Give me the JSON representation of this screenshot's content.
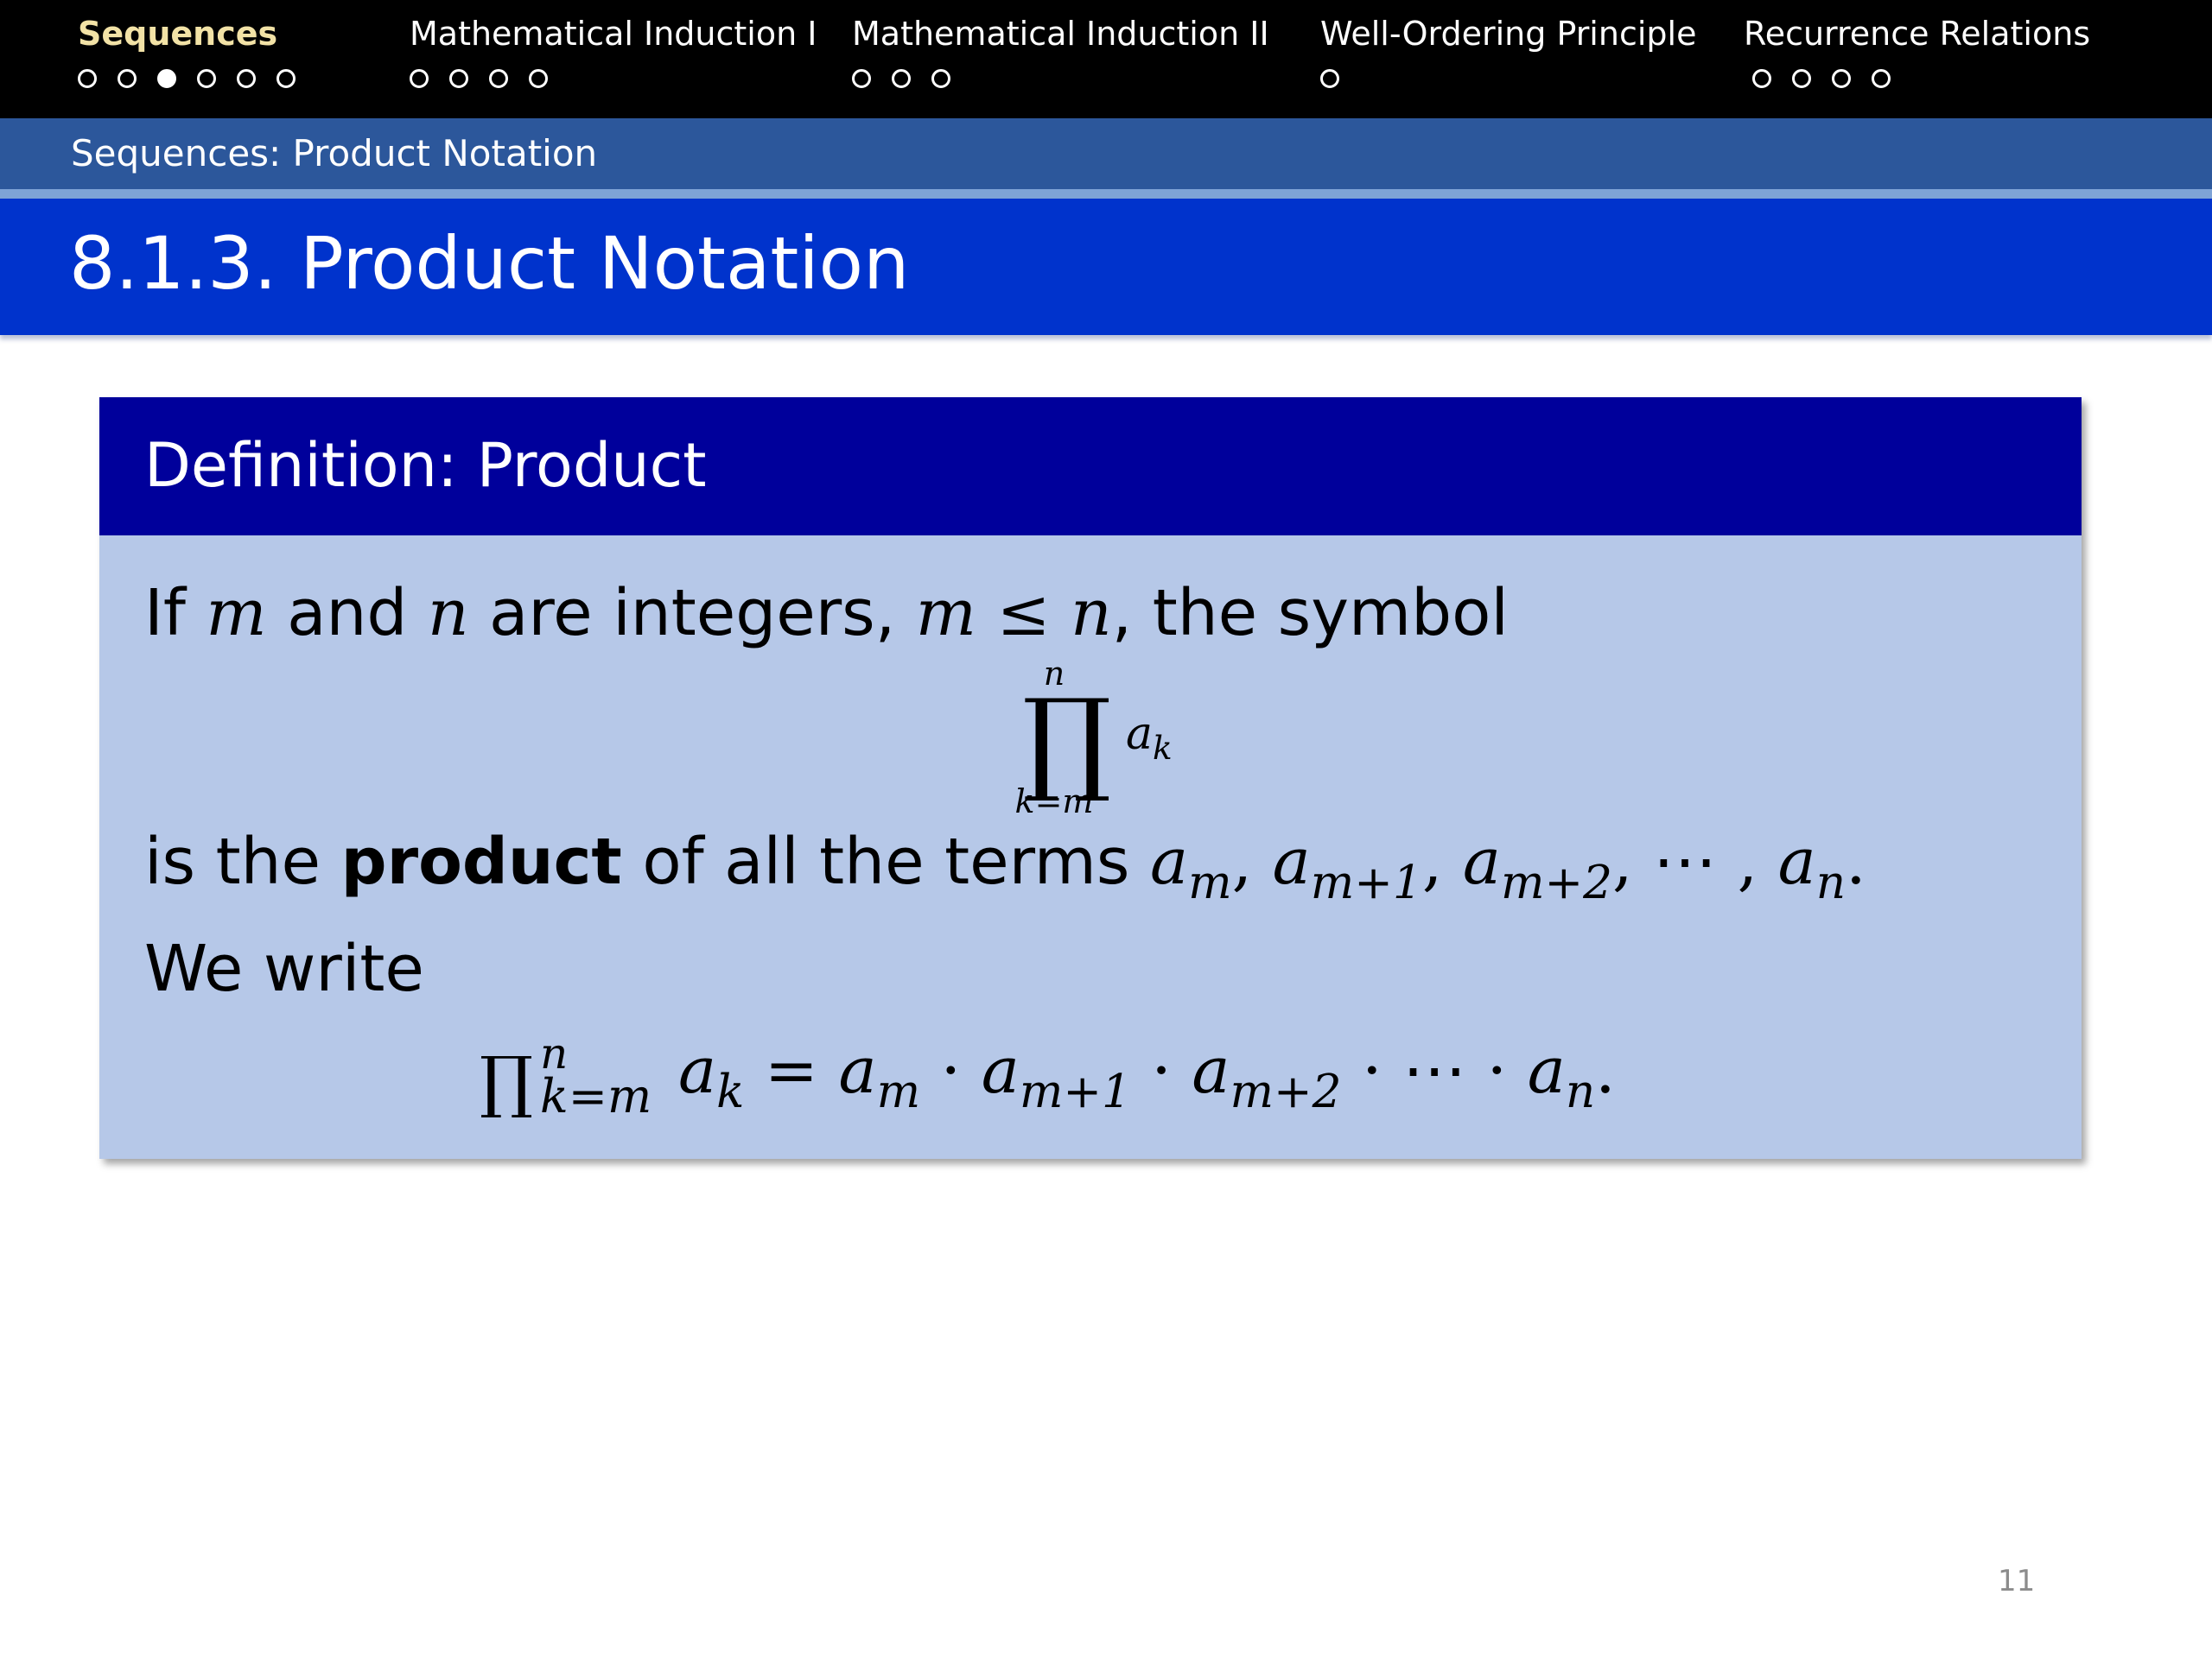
{
  "nav": {
    "sections": [
      {
        "label": "Sequences",
        "dots": 6,
        "active_dot": 3,
        "active": true
      },
      {
        "label": "Mathematical Induction I",
        "dots": 4,
        "active_dot": 0,
        "active": false
      },
      {
        "label": "Mathematical Induction II",
        "dots": 3,
        "active_dot": 0,
        "active": false
      },
      {
        "label": "Well-Ordering Principle",
        "dots": 1,
        "active_dot": 0,
        "active": false
      },
      {
        "label": "Recurrence Relations",
        "dots": 4,
        "active_dot": 0,
        "active": false
      }
    ]
  },
  "subtitle": "Sequences: Product Notation",
  "title": "8.1.3. Product Notation",
  "definition": {
    "header": "Definition: Product",
    "line1": {
      "t1": "If ",
      "v1": "m",
      "t2": " and ",
      "v2": "n",
      "t3": " are integers, ",
      "v3": "m",
      "op": " ≤ ",
      "v4": "n",
      "t4": ", the symbol"
    },
    "display": {
      "symbol": "∏",
      "upper": "n",
      "lower": "k=m",
      "term": "a",
      "term_sub": "k"
    },
    "line2": {
      "t1": "is the ",
      "bold": "product",
      "t2": " of all the terms ",
      "terms": "a",
      "s1": "m",
      "c1": ", ",
      "a2": "a",
      "s2": "m+1",
      "c2": ", ",
      "a3": "a",
      "s3": "m+2",
      "c3": ", ⋯ , ",
      "a4": "a",
      "s4": "n",
      "end": "."
    },
    "line3": "We write",
    "equation": {
      "symbol": "∏",
      "upper": "n",
      "lower": "k=m",
      "lhs_term": "a",
      "lhs_sub": "k",
      "eq": " = ",
      "r1": "a",
      "r1s": "m",
      "dot1": " · ",
      "r2": "a",
      "r2s": "m+1",
      "dot2": " · ",
      "r3": "a",
      "r3s": "m+2",
      "dot3": " · ⋯ · ",
      "r4": "a",
      "r4s": "n",
      "end": "."
    }
  },
  "page_number": "11",
  "colors": {
    "nav_bg": "#000000",
    "nav_active": "#f2e2a6",
    "subbar_bg": "#2c579b",
    "title_bg": "#0033cc",
    "def_header_bg": "#00009b",
    "def_body_bg": "#b6c8e8"
  }
}
